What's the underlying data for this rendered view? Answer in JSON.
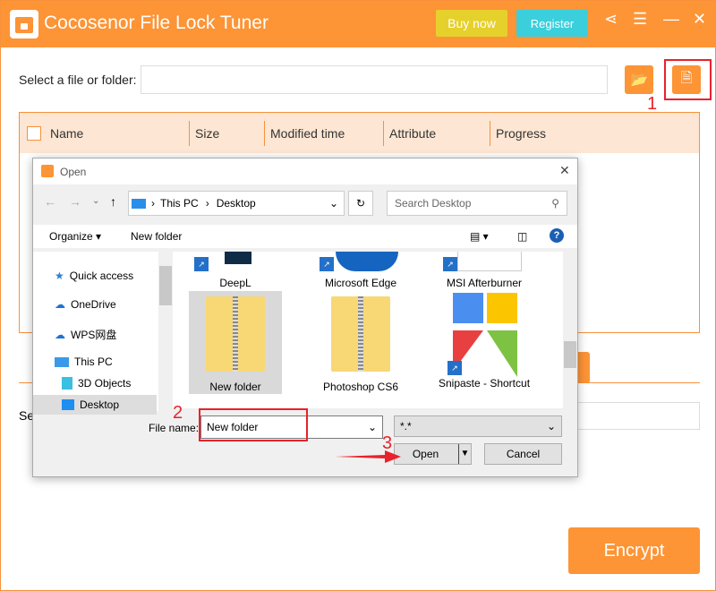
{
  "app": {
    "title": "Cocosenor File Lock Tuner",
    "buy_label": "Buy now",
    "register_label": "Register",
    "select_label": "Select a file or folder:",
    "select_value": "",
    "encrypt_label": "Encrypt",
    "second_label_partial": "Se",
    "accent": "#fd9435"
  },
  "table": {
    "columns": [
      "Name",
      "Size",
      "Modified time",
      "Attribute",
      "Progress"
    ]
  },
  "annotations": {
    "step1": "1",
    "step2": "2",
    "step3": "3"
  },
  "dialog": {
    "title": "Open",
    "breadcrumb": [
      "This PC",
      "Desktop"
    ],
    "search_placeholder": "Search Desktop",
    "organize": "Organize",
    "new_folder": "New folder",
    "nav": [
      "Quick access",
      "OneDrive",
      "WPS网盘",
      "This PC",
      "3D Objects",
      "Desktop"
    ],
    "files": [
      {
        "name": "DeepL"
      },
      {
        "name": "Microsoft Edge"
      },
      {
        "name": "MSI Afterburner"
      },
      {
        "name": "New folder"
      },
      {
        "name": "Photoshop CS6"
      },
      {
        "name": "Snipaste - Shortcut"
      }
    ],
    "file_name_label": "File name:",
    "file_name_value": "New folder",
    "filter_value": "*.*",
    "open_label": "Open",
    "cancel_label": "Cancel"
  }
}
